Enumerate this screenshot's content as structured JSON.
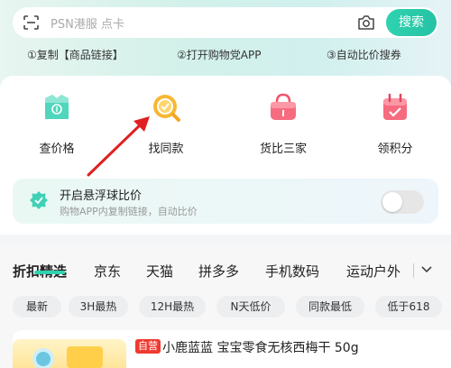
{
  "search": {
    "placeholder": "PSN港服 点卡",
    "button": "搜索",
    "scan_icon": "scan-icon",
    "camera_icon": "camera-icon"
  },
  "steps": [
    "①复制【商品链接】",
    "②打开购物党APP",
    "③自动比价搜券"
  ],
  "tools": [
    {
      "label": "查价格",
      "icon": "price-tag-icon",
      "color": "#3fd1b6"
    },
    {
      "label": "找同款",
      "icon": "magnifier-icon",
      "color": "#f5a623"
    },
    {
      "label": "货比三家",
      "icon": "basket-icon",
      "color": "#f2556c"
    },
    {
      "label": "领积分",
      "icon": "calendar-icon",
      "color": "#f2556c"
    }
  ],
  "float": {
    "title": "开启悬浮球比价",
    "subtitle": "购物APP内复制链接，自动比价",
    "toggle_on": false
  },
  "categories": [
    "折扣精选",
    "京东",
    "天猫",
    "拼多多",
    "手机数码",
    "运动户外"
  ],
  "active_category": 0,
  "chips": [
    "最新",
    "3H最热",
    "12H最热",
    "N天低价",
    "同款最低",
    "低于618"
  ],
  "product": {
    "badge": "自营",
    "title": "小鹿蓝蓝 宝宝零食无核西梅干 50g"
  },
  "colors": {
    "accent": "#2ed3b0",
    "arrow": "#e02020",
    "badge": "#f0392f"
  }
}
